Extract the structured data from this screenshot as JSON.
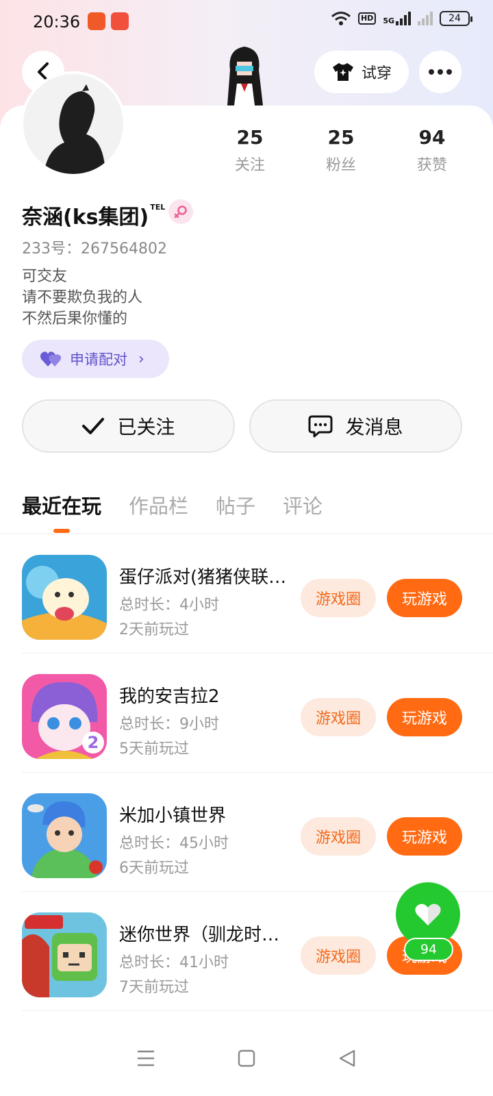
{
  "status_bar": {
    "time": "20:36",
    "network": "5G",
    "hd_badge": "HD",
    "battery": "24"
  },
  "header": {
    "tryon_label": "试穿"
  },
  "profile": {
    "stats": [
      {
        "value": "25",
        "label": "关注"
      },
      {
        "value": "25",
        "label": "粉丝"
      },
      {
        "value": "94",
        "label": "获赞"
      }
    ],
    "nickname": "奈涵(ks集团)",
    "nickname_sup": "TEL",
    "uid": "233号：267564802",
    "bio": [
      "可交友",
      "请不要欺负我的人",
      "不然后果你懂的"
    ],
    "pair_label": "申请配对"
  },
  "actions": {
    "followed_label": "已关注",
    "message_label": "发消息"
  },
  "tabs": [
    {
      "label": "最近在玩",
      "active": true
    },
    {
      "label": "作品栏",
      "active": false
    },
    {
      "label": "帖子",
      "active": false
    },
    {
      "label": "评论",
      "active": false
    }
  ],
  "games": [
    {
      "name": "蛋仔派对(猪猪侠联…",
      "duration": "总时长：4小时",
      "last_played": "2天前玩过",
      "circle_label": "游戏圈",
      "play_label": "玩游戏"
    },
    {
      "name": "我的安吉拉2",
      "duration": "总时长：9小时",
      "last_played": "5天前玩过",
      "circle_label": "游戏圈",
      "play_label": "玩游戏"
    },
    {
      "name": "米加小镇世界",
      "duration": "总时长：45小时",
      "last_played": "6天前玩过",
      "circle_label": "游戏圈",
      "play_label": "玩游戏"
    },
    {
      "name": "迷你世界（驯龙时…",
      "duration": "总时长：41小时",
      "last_played": "7天前玩过",
      "circle_label": "游戏圈",
      "play_label": "玩游戏"
    }
  ],
  "like_fab": {
    "count": "94"
  },
  "colors": {
    "accent_orange": "#ff6a13",
    "pair_purple": "#5f52cc",
    "like_green": "#23c92e"
  }
}
